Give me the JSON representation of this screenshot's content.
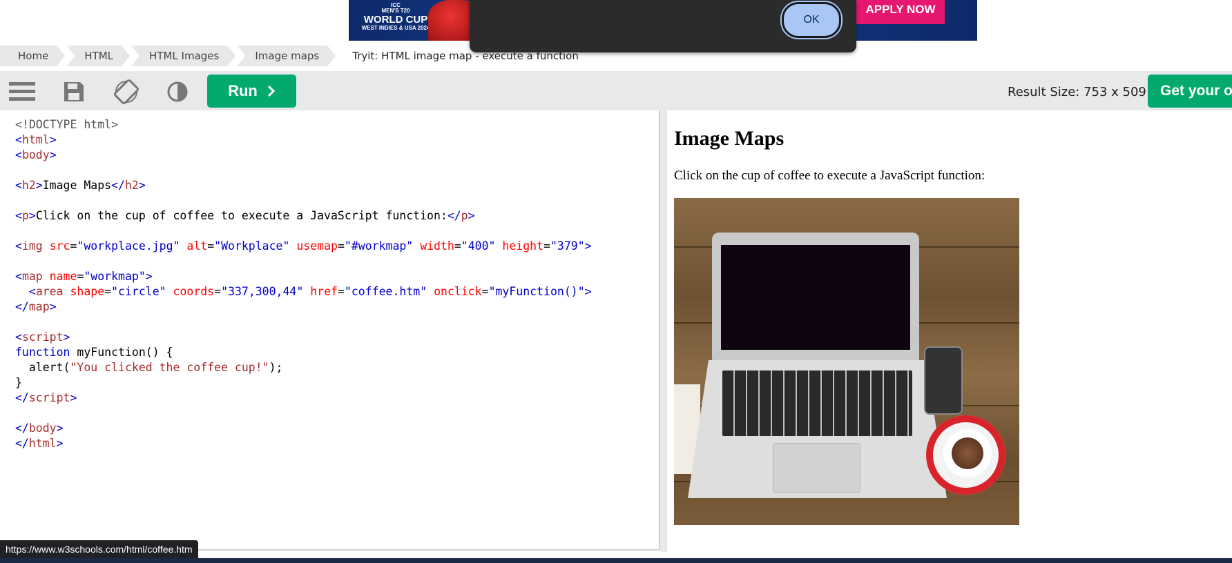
{
  "ad": {
    "brand": "ICC",
    "event_line1": "MEN'S T20",
    "event_line2": "WORLD CUP",
    "event_line3": "WEST INDIES & USA 2024",
    "cta": "APPLY NOW"
  },
  "alert": {
    "ok_label": "OK"
  },
  "breadcrumb": {
    "items": [
      "Home",
      "HTML",
      "HTML Images",
      "Image maps"
    ],
    "current": "Tryit: HTML image map - execute a function"
  },
  "toolbar": {
    "menu_icon": "hamburger-icon",
    "save_icon": "save-icon",
    "rotate_icon": "rotate-icon",
    "theme_icon": "contrast-icon",
    "run_label": "Run",
    "result_size": "Result Size: 753 x 509",
    "get_own_label": "Get your own"
  },
  "colors": {
    "accent": "#04aa6d",
    "toolbar_bg": "#e7e9eb",
    "tag": "#a52a2a",
    "attr": "#ff0000",
    "value": "#0000cd"
  },
  "result": {
    "heading": "Image Maps",
    "paragraph": "Click on the cup of coffee to execute a JavaScript function:",
    "image_alt": "Workplace"
  },
  "status_url": "https://www.w3schools.com/html/coffee.htm"
}
